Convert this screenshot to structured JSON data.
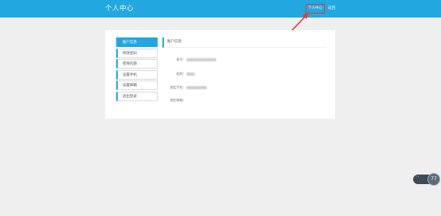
{
  "header": {
    "title": "个人中心",
    "personal_link": "个人中心",
    "back_link": "返回"
  },
  "colors": {
    "brand": "#22a7e0",
    "highlight": "#e53935",
    "background": "#efefef"
  },
  "sidebar": {
    "items": [
      {
        "label": "账户信息",
        "active": true
      },
      {
        "label": "修改密码",
        "active": false
      },
      {
        "label": "密保问题",
        "active": false
      },
      {
        "label": "设置手机",
        "active": false
      },
      {
        "label": "设置邮箱",
        "active": false
      },
      {
        "label": "退出登录",
        "active": false
      }
    ]
  },
  "account": {
    "section_title": "账户信息",
    "fields": [
      {
        "label": "账号:"
      },
      {
        "label": "昵称:"
      },
      {
        "label": "绑定手机:"
      },
      {
        "label": "绑定邮箱:"
      }
    ]
  },
  "widget": {
    "value": "77"
  }
}
